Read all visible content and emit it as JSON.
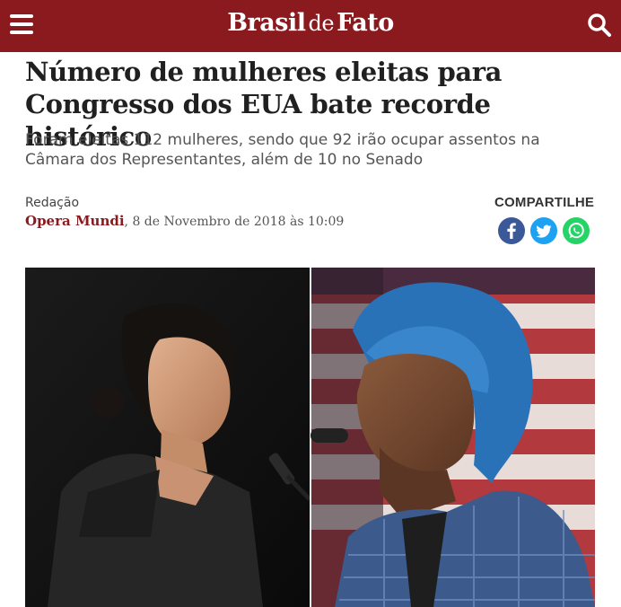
{
  "header": {
    "brand_main": "Brasil",
    "brand_de": "de",
    "brand_end": "Fato",
    "brand_color": "#8b1a1f"
  },
  "icons": {
    "menu": "hamburger-icon",
    "search": "search-icon"
  },
  "article": {
    "headline": "Número de mulheres eleitas para Congresso dos EUA bate recorde histórico",
    "subtitle": "Foram eleitas 112 mulheres, sendo que 92 irão ocupar assentos na Câmara dos Representantes, além de 10 no Senado",
    "author_label": "Redação",
    "source": "Opera Mundi",
    "separator": ",",
    "date": "8 de Novembro de 2018 às 10:09"
  },
  "share": {
    "label": "COMPARTILHE",
    "networks": [
      "facebook",
      "twitter",
      "whatsapp"
    ]
  }
}
